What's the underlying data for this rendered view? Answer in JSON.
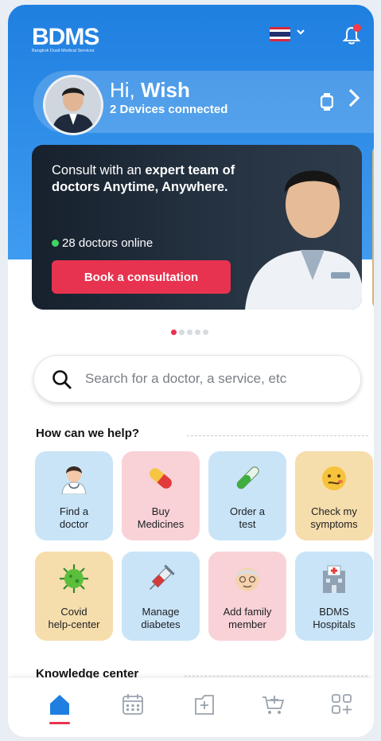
{
  "app": {
    "logo_text": "BDMS",
    "logo_subtext": "Bangkok Dusit Medical Services"
  },
  "colors": {
    "primary_blue": "#1f7fe0",
    "accent_red": "#e7334f",
    "online_green": "#3fd463"
  },
  "header": {
    "language_flag": "thailand-flag-icon",
    "dropdown_icon": "chevron-down-icon",
    "notification_icon": "bell-icon"
  },
  "greeting": {
    "hi": "Hi,",
    "name": "Wish",
    "devices": "2 Devices connected"
  },
  "banner": {
    "line_1": "Consult with an ",
    "line_1_bold": "expert team of doctors Anytime, Anywhere.",
    "online_text": "28 doctors online",
    "button_label": "Book a consultation",
    "slide_count": 5,
    "active_slide": 1
  },
  "search": {
    "placeholder": "Search for a doctor, a service, etc"
  },
  "help_section": {
    "title": "How can we help?",
    "tiles": [
      {
        "line1": "Find a",
        "line2": "doctor",
        "icon": "doctor-icon",
        "color": "blue"
      },
      {
        "line1": "Buy",
        "line2": "Medicines",
        "icon": "pill-icon",
        "color": "pink"
      },
      {
        "line1": "Order a",
        "line2": "test",
        "icon": "test-tube-icon",
        "color": "blue"
      },
      {
        "line1": "Check my",
        "line2": "symptoms",
        "icon": "sick-face-icon",
        "color": "yellow"
      },
      {
        "line1": "Covid",
        "line2": "help-center",
        "icon": "virus-icon",
        "color": "yellow"
      },
      {
        "line1": "Manage",
        "line2": "diabetes",
        "icon": "syringe-icon",
        "color": "blue"
      },
      {
        "line1": "Add family",
        "line2": "member",
        "icon": "grandparent-icon",
        "color": "pink"
      },
      {
        "line1": "BDMS",
        "line2": "Hospitals",
        "icon": "hospital-icon",
        "color": "blue"
      }
    ]
  },
  "knowledge_section": {
    "title": "Knowledge center"
  },
  "bottom_nav": {
    "items": [
      "home-icon",
      "calendar-icon",
      "medical-record-icon",
      "cart-icon",
      "more-apps-icon"
    ],
    "active": 0
  }
}
